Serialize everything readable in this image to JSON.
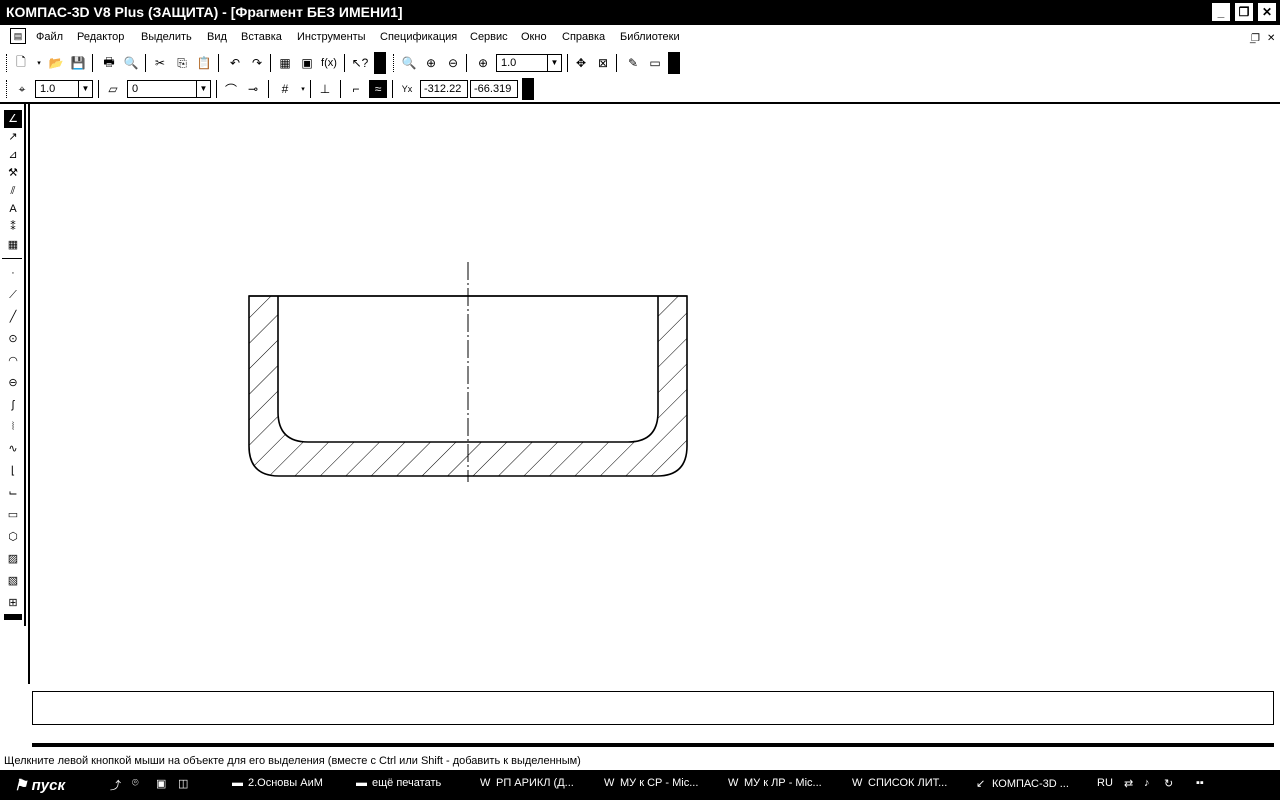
{
  "window": {
    "title": "КОМПАС-3D V8 Plus (ЗАЩИТА) - [Фрагмент БЕЗ ИМЕНИ1]",
    "title_icon": "kompas-icon",
    "buttons": [
      "_",
      "❐",
      "✕"
    ]
  },
  "menu": {
    "items": [
      "Файл",
      "Редактор",
      "Выделить",
      "Вид",
      "Вставка",
      "Инструменты",
      "Спецификация",
      "Сервис",
      "Окно",
      "Справка",
      "Библиотеки"
    ],
    "mdi_buttons": [
      "_",
      "❐",
      "✕"
    ]
  },
  "toolbar1": {
    "zoom_value": "1.0"
  },
  "toolbar2": {
    "step_value": "1.0",
    "layer_value": "0",
    "coord_x": "-312.22",
    "coord_y": "-66.319"
  },
  "command_line": {
    "text": ""
  },
  "status": {
    "text": "Щелкните левой кнопкой мыши на объекте для его выделения (вместе с Ctrl или Shift - добавить к выделенным)"
  },
  "taskbar": {
    "start_label": "пуск",
    "tasks": [
      {
        "label": "2.Основы АиМ",
        "icon": "folder-icon"
      },
      {
        "label": "ещё печатать",
        "icon": "folder-icon"
      },
      {
        "label": "РП АРИКЛ (Д...",
        "icon": "word-icon"
      },
      {
        "label": "МУ к СР - Mic...",
        "icon": "word-icon"
      },
      {
        "label": "МУ к ЛР - Mic...",
        "icon": "word-icon"
      },
      {
        "label": "СПИСОК ЛИТ...",
        "icon": "word-icon"
      },
      {
        "label": "КОМПАС-3D ...",
        "icon": "kompas-icon"
      }
    ],
    "lang": "RU"
  }
}
